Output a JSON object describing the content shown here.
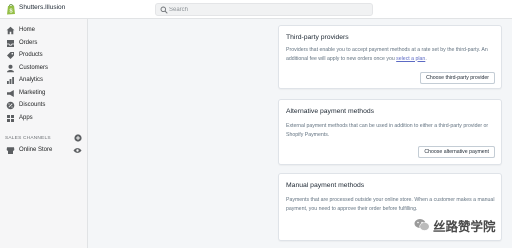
{
  "topbar": {
    "store_name": "Shutters.Illusion",
    "search_placeholder": "Search"
  },
  "sidebar": {
    "items": [
      {
        "label": "Home",
        "icon": "home-icon"
      },
      {
        "label": "Orders",
        "icon": "orders-icon"
      },
      {
        "label": "Products",
        "icon": "products-icon"
      },
      {
        "label": "Customers",
        "icon": "customers-icon"
      },
      {
        "label": "Analytics",
        "icon": "analytics-icon"
      },
      {
        "label": "Marketing",
        "icon": "marketing-icon"
      },
      {
        "label": "Discounts",
        "icon": "discounts-icon"
      },
      {
        "label": "Apps",
        "icon": "apps-icon"
      }
    ],
    "channels_title": "SALES CHANNELS",
    "channels": [
      {
        "label": "Online Store",
        "icon": "online-store-icon"
      }
    ]
  },
  "cards": [
    {
      "title": "Third-party providers",
      "description": "Providers that enable you to accept payment methods at a rate set by the third-party. An additional fee will apply to new orders once you",
      "link_text": "select a plan",
      "description_end": ".",
      "button": "Choose third-party provider"
    },
    {
      "title": "Alternative payment methods",
      "description": "External payment methods that can be used in addition to either a third-party provider or Shopify Payments.",
      "button": "Choose alternative payment"
    },
    {
      "title": "Manual payment methods",
      "description": "Payments that are processed outside your online store. When a customer makes a manual payment, you need to approve their order before fulfilling."
    }
  ],
  "watermark": {
    "text": "丝路赞学院"
  },
  "colors": {
    "accent": "#5c6ac4",
    "sidebar_bg": "#f6f6f7",
    "page_bg": "#f4f6f8",
    "logo_green": "#95bf47"
  }
}
